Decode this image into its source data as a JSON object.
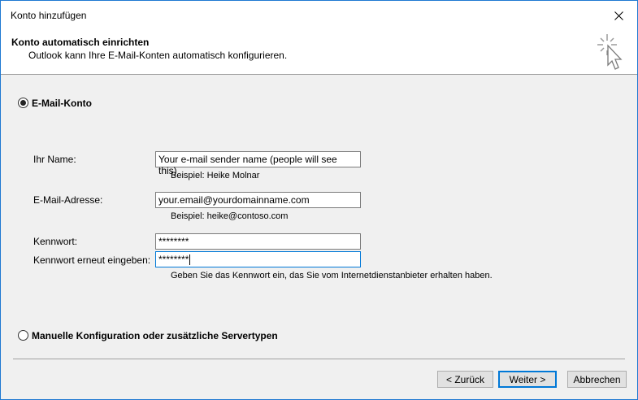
{
  "window": {
    "title": "Konto hinzufügen"
  },
  "header": {
    "title": "Konto automatisch einrichten",
    "subtitle": "Outlook kann Ihre E-Mail-Konten automatisch konfigurieren.",
    "icon": "wizard-sparkle-cursor-icon"
  },
  "options": {
    "email_account_label": "E-Mail-Konto",
    "email_account_selected": true,
    "manual_config_label": "Manuelle Konfiguration oder zusätzliche Servertypen",
    "manual_config_selected": false
  },
  "form": {
    "name_label": "Ihr Name:",
    "name_value": "Your e-mail sender name (people will see this)",
    "name_hint": "Beispiel: Heike Molnar",
    "email_label": "E-Mail-Adresse:",
    "email_value": "your.email@yourdomainname.com",
    "email_hint": "Beispiel: heike@contoso.com",
    "password_label": "Kennwort:",
    "password_value": "********",
    "password_repeat_label": "Kennwort erneut eingeben:",
    "password_repeat_value": "********",
    "password_hint": "Geben Sie das Kennwort ein, das Sie vom Internetdienstanbieter erhalten haben."
  },
  "buttons": {
    "back": "< Zurück",
    "next": "Weiter >",
    "cancel": "Abbrechen"
  },
  "colors": {
    "window_border": "#1e78d2",
    "focus_accent": "#0078d7",
    "dialog_bg": "#f0f0f0"
  }
}
